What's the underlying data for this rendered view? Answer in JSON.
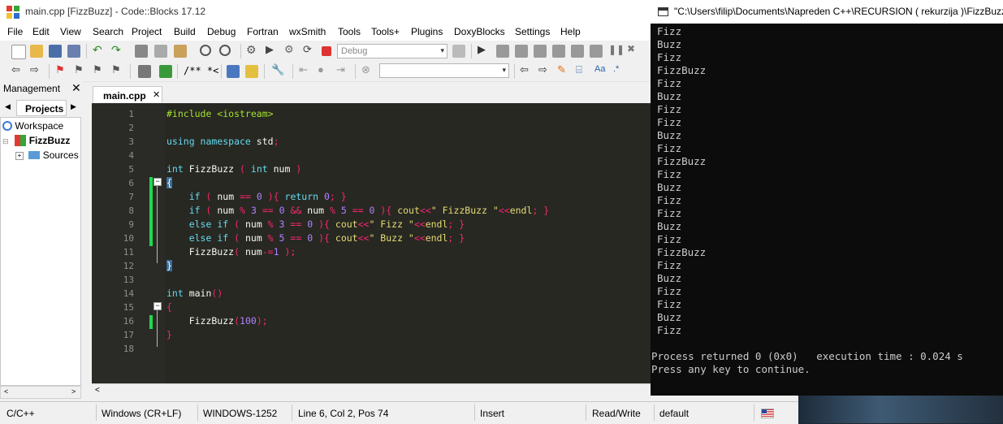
{
  "ide": {
    "window_title": "main.cpp [FizzBuzz] - Code::Blocks 17.12",
    "menu": [
      "File",
      "Edit",
      "View",
      "Search",
      "Project",
      "Build",
      "Debug",
      "Fortran",
      "wxSmith",
      "Tools",
      "Tools+",
      "Plugins",
      "DoxyBlocks",
      "Settings",
      "Help"
    ],
    "build_target": "Debug",
    "toolbar2_text": "/** *<"
  },
  "management": {
    "title": "Management",
    "close": "✕",
    "tab": "Projects",
    "tree": {
      "workspace": "Workspace",
      "project": "FizzBuzz",
      "sources": "Sources"
    }
  },
  "editor": {
    "tab_label": "main.cpp",
    "tab_close": "✕",
    "line_numbers": [
      "1",
      "2",
      "3",
      "4",
      "5",
      "6",
      "7",
      "8",
      "9",
      "10",
      "11",
      "12",
      "13",
      "14",
      "15",
      "16",
      "17",
      "18"
    ],
    "lines": [
      "#include <iostream>",
      "",
      "using namespace std;",
      "",
      "int FizzBuzz ( int num )",
      "{",
      "    if ( num == 0 ){ return 0; }",
      "    if ( num % 3 == 0 && num % 5 == 0 ){ cout<<\" FizzBuzz \"<<endl; }",
      "    else if ( num % 3 == 0 ){ cout<<\" Fizz \"<<endl; }",
      "    else if ( num % 5 == 0 ){ cout<<\" Buzz \"<<endl; }",
      "    FizzBuzz( num-=1 );",
      "}",
      "",
      "int main()",
      "{",
      "    FizzBuzz(100);",
      "}",
      ""
    ]
  },
  "status": {
    "language": "C/C++",
    "line_endings": "Windows (CR+LF)",
    "encoding": "WINDOWS-1252",
    "position": "Line 6, Col 2, Pos 74",
    "mode": "Insert",
    "access": "Read/Write",
    "style": "default"
  },
  "console": {
    "title": "\"C:\\Users\\filip\\Documents\\Napreden C++\\RECURSION ( rekurzija )\\FizzBuzz\\",
    "output": [
      "Fizz",
      "Buzz",
      "Fizz",
      "FizzBuzz",
      "Fizz",
      "Buzz",
      "Fizz",
      "Fizz",
      "Buzz",
      "Fizz",
      "FizzBuzz",
      "Fizz",
      "Buzz",
      "Fizz",
      "Fizz",
      "Buzz",
      "Fizz",
      "FizzBuzz",
      "Fizz",
      "Buzz",
      "Fizz",
      "Fizz",
      "Buzz",
      "Fizz"
    ],
    "result_line": "Process returned 0 (0x0)   execution time : 0.024 s",
    "prompt_line": "Press any key to continue."
  },
  "colors": {
    "editor_bg": "#272822",
    "keyword": "#66d9ef",
    "operator": "#f92672",
    "number": "#ae81ff",
    "string": "#e6db74",
    "changebar": "#22d84e",
    "console_bg": "#0c0c0c",
    "console_text": "#cccccc"
  }
}
